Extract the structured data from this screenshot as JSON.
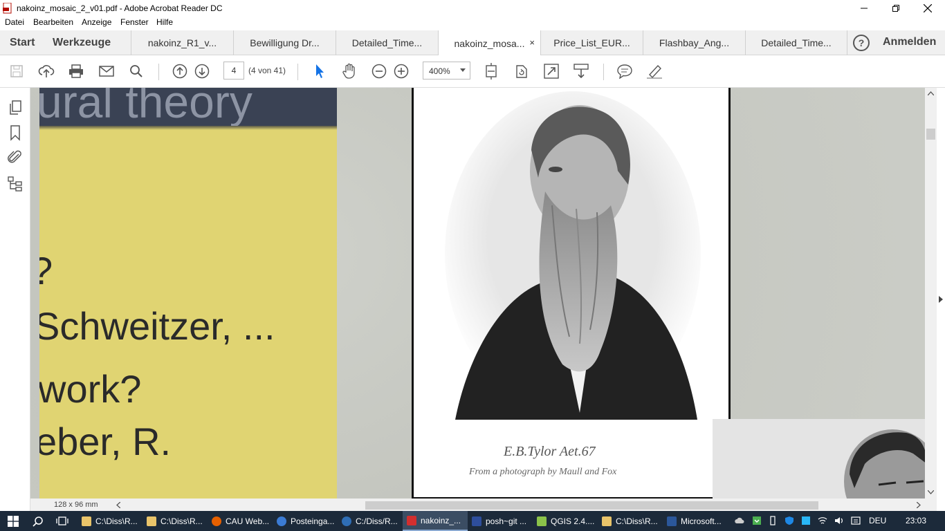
{
  "window": {
    "title": "nakoinz_mosaic_2_v01.pdf - Adobe Acrobat Reader DC",
    "controls": [
      "minimize",
      "restore",
      "close"
    ]
  },
  "menu": [
    "Datei",
    "Bearbeiten",
    "Anzeige",
    "Fenster",
    "Hilfe"
  ],
  "nav": {
    "start": "Start",
    "tools": "Werkzeuge",
    "help": "?",
    "login": "Anmelden"
  },
  "tabs": [
    {
      "label": "nakoinz_R1_v...",
      "active": false
    },
    {
      "label": "Bewilligung Dr...",
      "active": false
    },
    {
      "label": "Detailed_Time...",
      "active": false
    },
    {
      "label": "nakoinz_mosa...",
      "active": true,
      "close": "×"
    },
    {
      "label": "Price_List_EUR...",
      "active": false
    },
    {
      "label": "Flashbay_Ang...",
      "active": false
    },
    {
      "label": "Detailed_Time...",
      "active": false
    }
  ],
  "toolbar": {
    "icons": [
      "save-icon",
      "upload-icon",
      "print-icon",
      "email-icon",
      "search-icon",
      "prev-page-icon",
      "next-page-icon",
      "select-arrow-icon",
      "hand-icon",
      "zoom-out-icon",
      "zoom-in-icon",
      "fit-page-icon",
      "rotate-icon",
      "fullscreen-icon",
      "scroll-mode-icon",
      "comment-icon",
      "highlight-icon"
    ],
    "page_number": "4",
    "page_count": "(4 von 41)",
    "zoom": "400%"
  },
  "sidebar_icons": [
    "pages-icon",
    "bookmark-icon",
    "attachment-icon",
    "structure-icon"
  ],
  "document": {
    "slide_heading": "ural theory",
    "slide_lines": [
      "?",
      "Schweitzer, ...",
      "work?",
      "eber, R."
    ],
    "caption_1": "E.B.Tylor  Aet.67",
    "caption_2": "From a photograph by Maull and Fox",
    "page_dimensions": "128 x 96 mm"
  },
  "taskbar": {
    "items": [
      {
        "label": "C:\\Diss\\R...",
        "color": "#e9c46a",
        "active": false
      },
      {
        "label": "C:\\Diss\\R...",
        "color": "#e9c46a",
        "active": false
      },
      {
        "label": "CAU Web...",
        "color": "#e66000",
        "active": false
      },
      {
        "label": "Posteinga...",
        "color": "#3b7bd4",
        "active": false
      },
      {
        "label": "C:/Diss/R...",
        "color": "#2f6eb5",
        "active": false
      },
      {
        "label": "nakoinz_...",
        "color": "#d32f2f",
        "active": true
      },
      {
        "label": "posh~git ...",
        "color": "#2e4e9c",
        "active": false
      },
      {
        "label": "QGIS 2.4....",
        "color": "#8bc34a",
        "active": false
      },
      {
        "label": "C:\\Diss\\R...",
        "color": "#e9c46a",
        "active": false
      },
      {
        "label": "Microsoft...",
        "color": "#2b579a",
        "active": false
      }
    ],
    "language": "DEU",
    "time": "23:03"
  },
  "colors": {
    "accent": "#1473e6",
    "slide_yellow": "#e0d472",
    "slide_header": "#3a4254"
  }
}
